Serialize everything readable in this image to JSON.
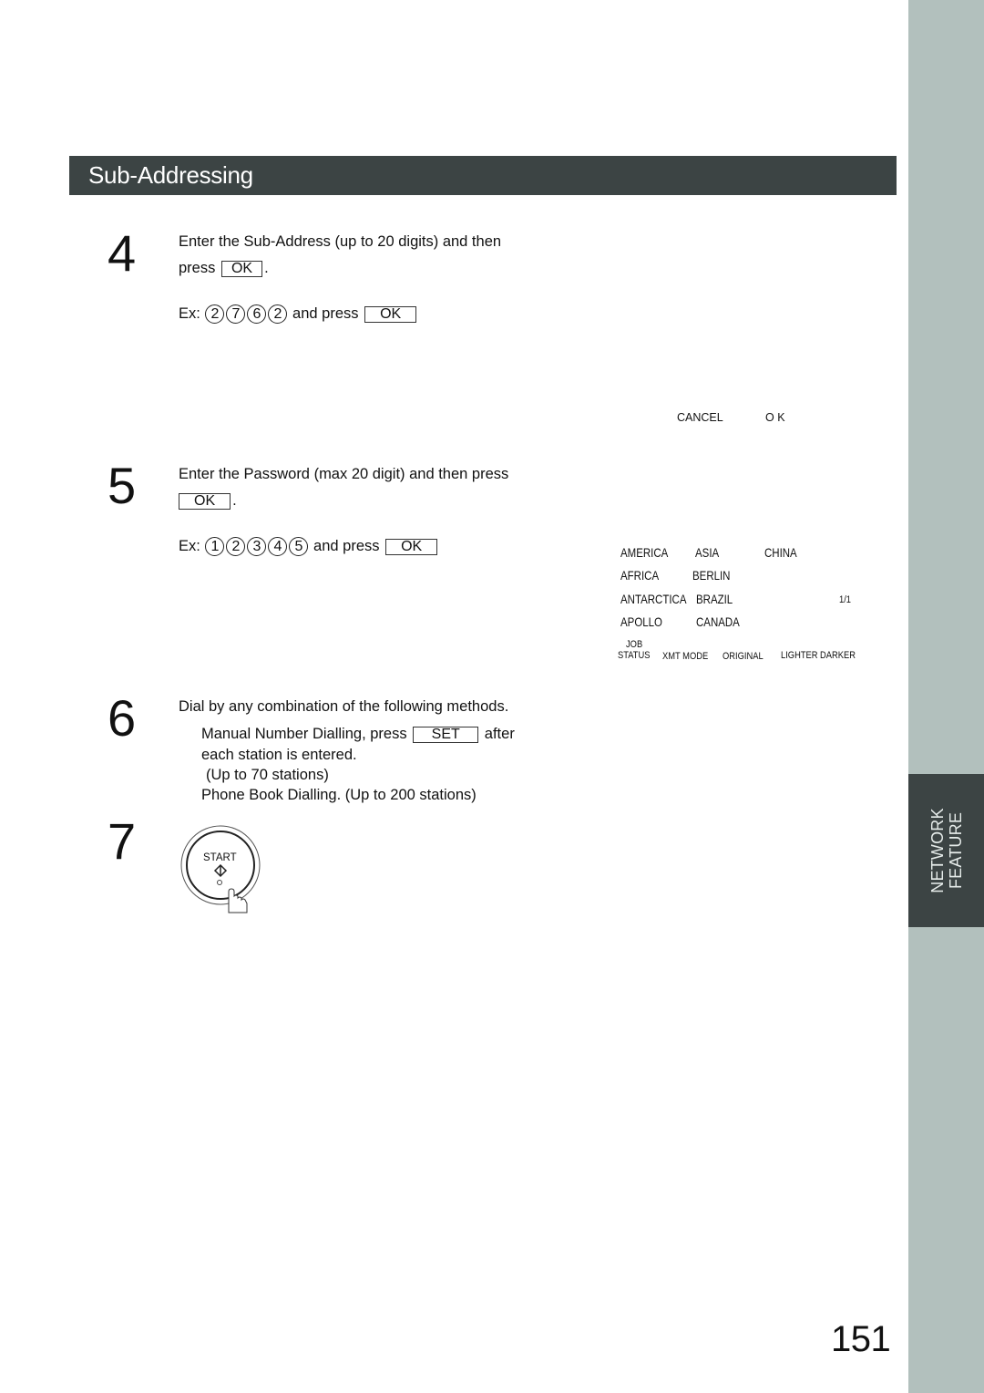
{
  "header": {
    "title": "Sub-Addressing"
  },
  "side_tab": {
    "line1": "NETWORK",
    "line2": "FEATURE"
  },
  "steps": [
    {
      "number": "4",
      "line1": "Enter the Sub-Address (up to 20 digits) and then",
      "line2_prefix": "press",
      "line2_key": "OK",
      "line2_suffix": ".",
      "example_prefix": "Ex:",
      "example_digits": [
        "2",
        "7",
        "6",
        "2"
      ],
      "example_mid": "and press",
      "example_key": "OK"
    },
    {
      "number": "5",
      "line1": "Enter the Password (max 20 digit) and then press",
      "line2_key": "OK",
      "line2_suffix": ".",
      "example_prefix": "Ex:",
      "example_digits": [
        "1",
        "2",
        "3",
        "4",
        "5"
      ],
      "example_mid": "and press",
      "example_key": "OK"
    },
    {
      "number": "6",
      "line1": "Dial by any combination of the following methods.",
      "line2_prefix": "Manual Number Dialling, press",
      "line2_key": "SET",
      "line2_suffix": "after",
      "line3": "each station is entered.",
      "line4": "(Up to 70 stations)",
      "line5": "Phone Book Dialling. (Up to 200 stations)"
    },
    {
      "number": "7",
      "button_label": "START"
    }
  ],
  "lcd_step4": {
    "cancel": "CANCEL",
    "ok": "O K"
  },
  "lcd_step5": {
    "rows": [
      [
        "AMERICA",
        "ASIA",
        "CHINA"
      ],
      [
        "AFRICA",
        "BERLIN"
      ],
      [
        "ANTARCTICA",
        "BRAZIL"
      ],
      [
        "APOLLO",
        "CANADA"
      ]
    ],
    "page_indicator": "1/1",
    "buttons": {
      "job_top": "JOB",
      "job_bottom": "STATUS",
      "xmt_mode": "XMT MODE",
      "original": "ORIGINAL",
      "lighter": "LIGHTER",
      "darker": "DARKER"
    }
  },
  "page_number": "151",
  "colors": {
    "header_bg": "#3c4444",
    "side_strip": "#b2c0bd",
    "side_tab_bg": "#3c4444"
  }
}
